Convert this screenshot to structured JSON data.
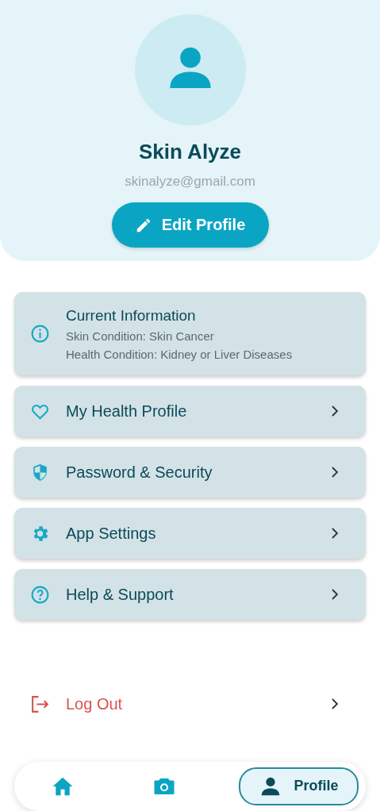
{
  "profile": {
    "name": "Skin Alyze",
    "email": "skinalyze@gmail.com",
    "edit_button": "Edit Profile"
  },
  "current_information": {
    "title": "Current Information",
    "lines": [
      "Skin Condition: Skin Cancer",
      "Health Condition: Kidney or Liver Diseases"
    ]
  },
  "menu": [
    {
      "label": "My Health Profile"
    },
    {
      "label": "Password & Security"
    },
    {
      "label": "App Settings"
    },
    {
      "label": "Help & Support"
    }
  ],
  "logout": {
    "label": "Log Out"
  },
  "bottom_nav": [
    {
      "selected": false
    },
    {
      "selected": false
    },
    {
      "label": "Profile",
      "selected": true
    }
  ]
}
